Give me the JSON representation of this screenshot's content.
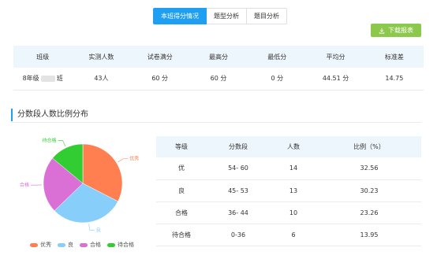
{
  "tabs": [
    "本班得分情况",
    "题型分析",
    "题目分析"
  ],
  "download_label": "下载报表",
  "stats": {
    "headers": [
      "班级",
      "实测人数",
      "试卷满分",
      "最高分",
      "最低分",
      "平均分",
      "标准差"
    ],
    "row": {
      "class_prefix": "8年级",
      "class_suffix": "班",
      "count": "43人",
      "full": "60 分",
      "max": "60 分",
      "min": "0 分",
      "avg": "44.51 分",
      "std": "14.75"
    }
  },
  "section_title": "分数段人数比例分布",
  "chart_data": {
    "type": "pie",
    "categories": [
      "优秀",
      "良",
      "合格",
      "待合格"
    ],
    "values": [
      32.56,
      30.23,
      23.26,
      13.95
    ],
    "colors": [
      "#ff7f50",
      "#87cefa",
      "#da70d6",
      "#32cd32"
    ],
    "legend_position": "bottom"
  },
  "grades": {
    "headers": [
      "等级",
      "分数段",
      "人数",
      "比例（%）"
    ],
    "rows": [
      [
        "优",
        "54- 60",
        "14",
        "32.56"
      ],
      [
        "良",
        "45- 53",
        "13",
        "30.23"
      ],
      [
        "合格",
        "36- 44",
        "10",
        "23.26"
      ],
      [
        "待合格",
        "0-36",
        "6",
        "13.95"
      ]
    ]
  }
}
